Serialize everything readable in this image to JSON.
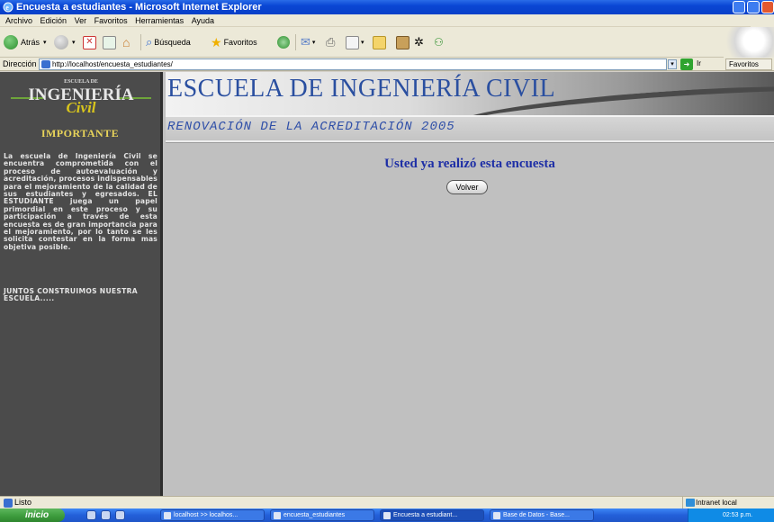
{
  "window": {
    "title": "Encuesta a estudiantes - Microsoft Internet Explorer"
  },
  "menu": [
    "Archivo",
    "Edición",
    "Ver",
    "Favoritos",
    "Herramientas",
    "Ayuda"
  ],
  "toolbar": {
    "back_label": "Atrás",
    "search_label": "Búsqueda",
    "favorites_label": "Favoritos"
  },
  "address": {
    "label": "Dirección",
    "url": "http://localhost/encuesta_estudiantes/",
    "go_label": "Ir",
    "favorites_label": "Favoritos"
  },
  "sidebar": {
    "logo_top": "ESCUELA DE",
    "logo_main": "INGENIERÍA",
    "logo_sub": "Civil",
    "heading": "IMPORTANTE",
    "body": "La escuela de Ingeniería Civil se encuentra comprometida con el proceso de autoevaluación y acreditación, procesos indispensables para el mejoramiento de la calidad de sus estudiantes y egresados. EL ESTUDIANTE juega un papel primordial en este proceso y su participación a través de esta encuesta es de gran importancia para el mejoramiento, por lo tanto se les solicita contestar en la forma mas objetiva posible.",
    "slogan": "JUNTOS CONSTRUIMOS NUESTRA ESCUELA....."
  },
  "banner": {
    "title": "ESCUELA DE INGENIERÍA CIVIL",
    "subtitle": "RENOVACIÓN DE LA ACREDITACIÓN 2005"
  },
  "main": {
    "message": "Usted ya realizó esta encuesta",
    "button_label": "Volver"
  },
  "status": {
    "text": "Listo",
    "zone": "Intranet local"
  },
  "taskbar": {
    "start_label": "inicio",
    "tasks": [
      "localhost >> localhos...",
      "encuesta_estudiantes",
      "Encuesta a estudiant...",
      "Base de Datos - Base..."
    ],
    "clock": "02:53 p.m."
  },
  "colors": {
    "sidebar_bg": "#4b4b4b",
    "content_bg": "#c0c0c0",
    "title_blue": "#2a4fa0",
    "message_blue": "#1e2fa6",
    "heading_gold": "#e8d45a"
  }
}
